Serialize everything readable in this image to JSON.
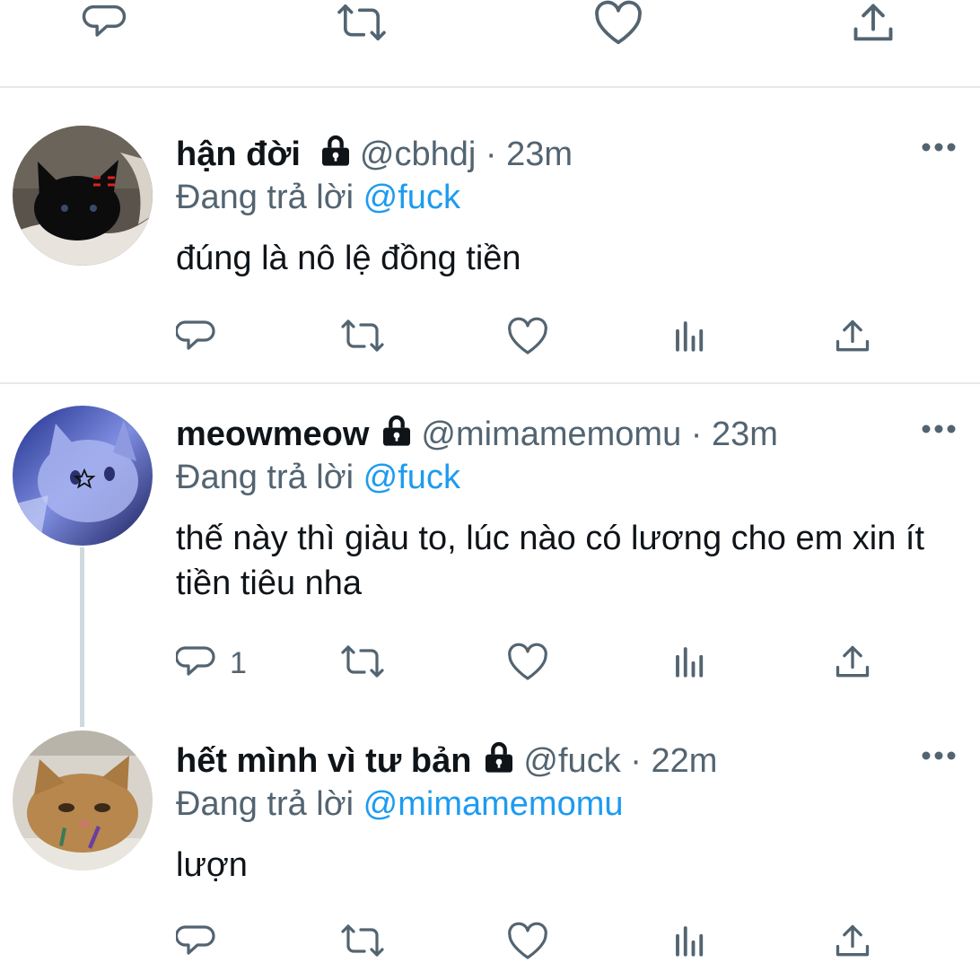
{
  "top_actions": {
    "icons": [
      "reply-icon",
      "retweet-icon",
      "like-icon",
      "share-icon"
    ]
  },
  "replies": [
    {
      "display_name": "hận đời",
      "handle": "@cbhdj",
      "separator": "·",
      "time": "23m",
      "replying_label": "Đang trả lời",
      "replying_to": "@fuck",
      "text": "đúng là nô lệ đồng tiền",
      "reply_count": "",
      "avatar": "black-kitten-photo"
    },
    {
      "display_name": "meowmeow",
      "handle": "@mimamemomu",
      "separator": "·",
      "time": "23m",
      "replying_label": "Đang trả lời",
      "replying_to": "@fuck",
      "text": "thế này thì giàu to, lúc nào có lương cho em xin ít tiền tiêu nha",
      "reply_count": "1",
      "avatar": "blue-cat-photo"
    },
    {
      "display_name": "hết mình vì tư bản",
      "handle": "@fuck",
      "separator": "·",
      "time": "22m",
      "replying_label": "Đang trả lời",
      "replying_to": "@mimamemomu",
      "text": "lượn",
      "reply_count": "",
      "avatar": "orange-cat-photo"
    }
  ],
  "colors": {
    "text": "#0f1419",
    "secondary": "#536471",
    "link": "#1d9bf0",
    "divider": "#e6e9eb",
    "thread_line": "#cfd9de"
  }
}
